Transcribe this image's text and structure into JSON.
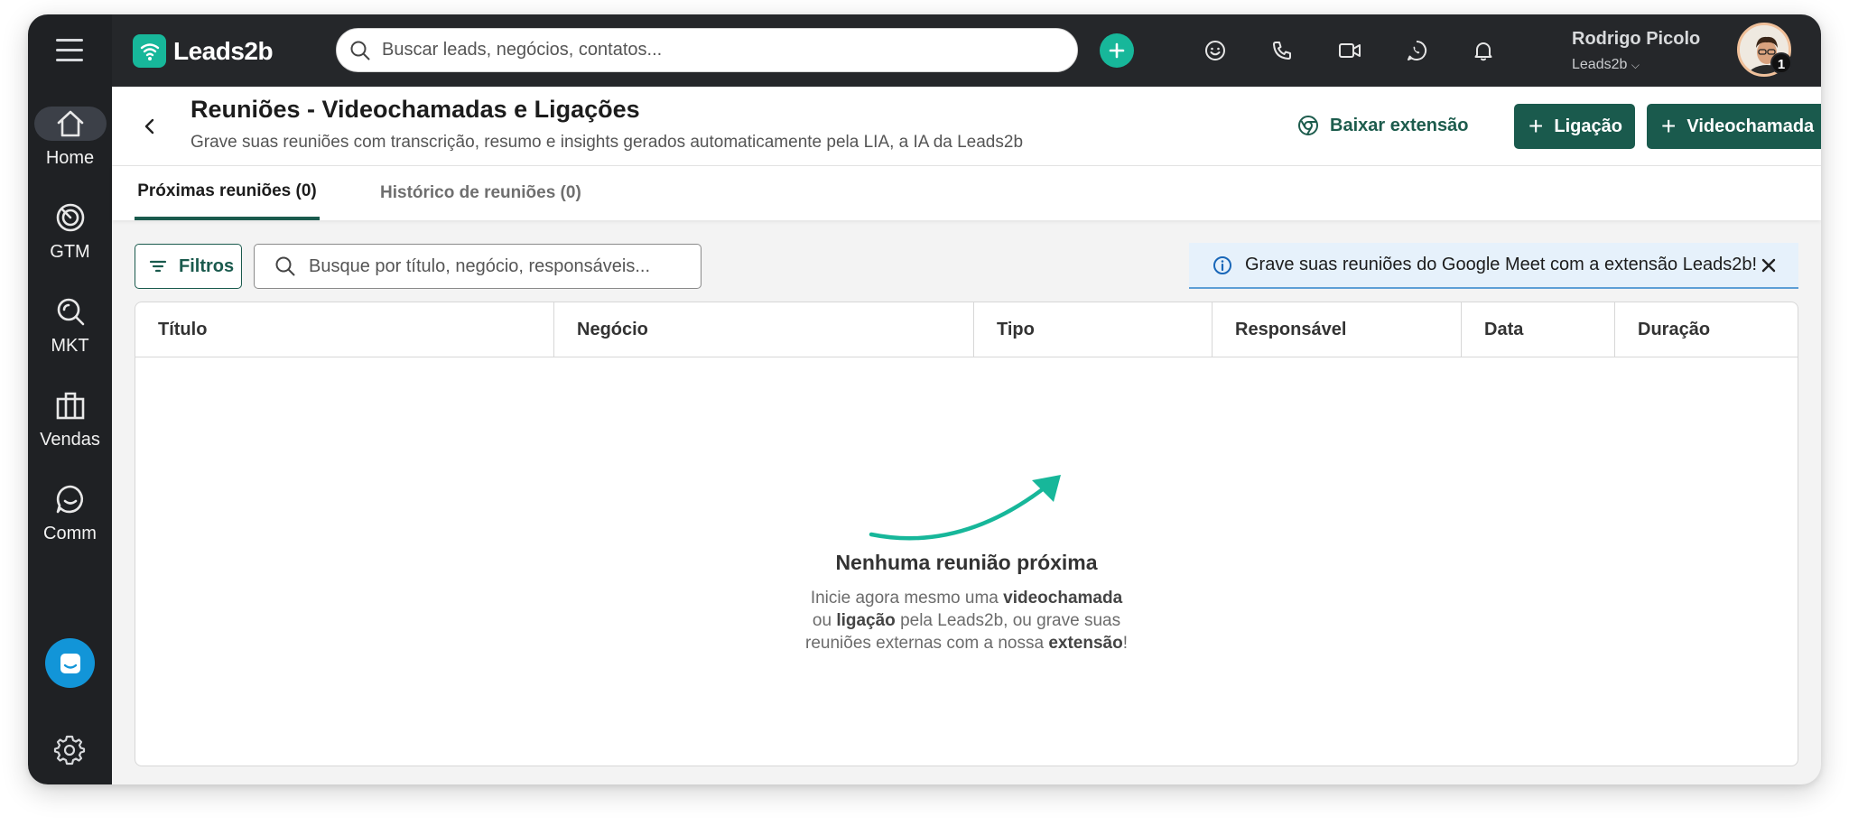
{
  "app": {
    "name": "Leads2b",
    "accent": "#17b79a",
    "primary": "#1a5a4d",
    "sidebar_bg": "#1f2124"
  },
  "sidebar": {
    "items": [
      {
        "label": "Home",
        "icon": "home-icon",
        "active": true
      },
      {
        "label": "GTM",
        "icon": "target-icon"
      },
      {
        "label": "MKT",
        "icon": "search-analytics-icon"
      },
      {
        "label": "Vendas",
        "icon": "briefcase-icon"
      },
      {
        "label": "Comm",
        "icon": "chat-bubble-icon"
      }
    ]
  },
  "topbar": {
    "search_placeholder": "Buscar leads, negócios, contatos...",
    "user_name": "Rodrigo Picolo",
    "user_org": "Leads2b",
    "notification_count": "1"
  },
  "header": {
    "title": "Reuniões - Videochamadas e Ligações",
    "subtitle": "Grave suas reuniões com transcrição, resumo e insights gerados automaticamente pela LIA, a IA da Leads2b",
    "extension_link": "Baixar extensão",
    "call_button": "Ligação",
    "video_button": "Videochamada"
  },
  "tabs": [
    {
      "label": "Próximas reuniões (0)",
      "active": true
    },
    {
      "label": "Histórico de reuniões (0)",
      "active": false
    }
  ],
  "toolbar": {
    "filters_label": "Filtros",
    "search_placeholder": "Busque por título, negócio, responsáveis..."
  },
  "banner": {
    "text": "Grave suas reuniões do Google Meet com a extensão Leads2b!"
  },
  "table": {
    "columns": [
      "Título",
      "Negócio",
      "Tipo",
      "Responsável",
      "Data",
      "Duração"
    ],
    "rows": []
  },
  "empty_state": {
    "title": "Nenhuma reunião próxima",
    "line1_pre": "Inicie agora mesmo uma ",
    "line1_bold": "videochamada",
    "line2_pre": "ou ",
    "line2_bold": "ligação",
    "line2_post": " pela Leads2b, ou grave suas",
    "line3_pre": "reuniões externas com a nossa ",
    "line3_bold": "extensão",
    "line3_post": "!"
  }
}
